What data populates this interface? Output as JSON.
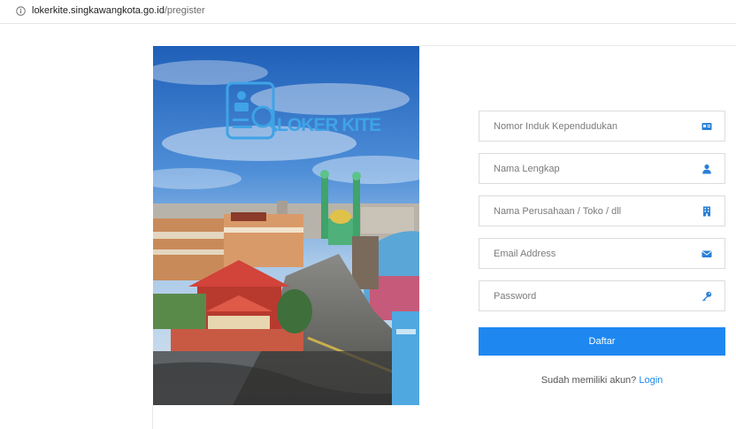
{
  "browser": {
    "url_host": "lokerkite.singkawangkota.go.id",
    "url_path": "/pregister"
  },
  "hero": {
    "logo_text": "LOKER KITE"
  },
  "form": {
    "fields": [
      {
        "placeholder": "Nomor Induk Kependudukan",
        "icon": "id-card-icon"
      },
      {
        "placeholder": "Nama Lengkap",
        "icon": "user-icon"
      },
      {
        "placeholder": "Nama Perusahaan / Toko / dll",
        "icon": "building-icon"
      },
      {
        "placeholder": "Email Address",
        "icon": "envelope-icon"
      },
      {
        "placeholder": "Password",
        "icon": "key-icon"
      }
    ],
    "submit_label": "Daftar",
    "login_prompt": "Sudah memiliki akun?",
    "login_link": "Login"
  },
  "colors": {
    "accent": "#1e88f0",
    "icon": "#2a7fd6"
  }
}
